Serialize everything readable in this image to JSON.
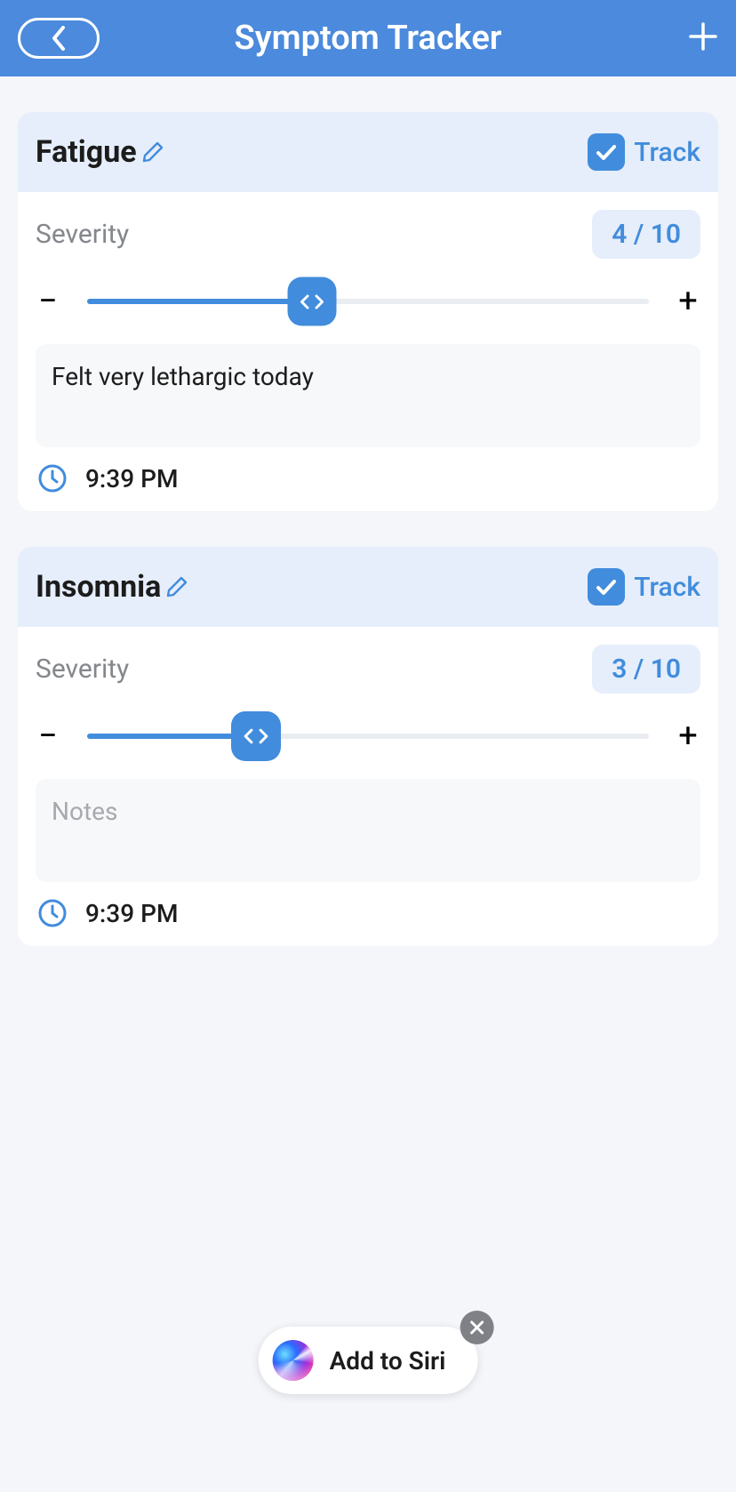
{
  "header": {
    "title": "Symptom Tracker"
  },
  "track_label": "Track",
  "severity_label": "Severity",
  "severity_max": 10,
  "notes_placeholder": "Notes",
  "symptoms": [
    {
      "name": "Fatigue",
      "tracked": true,
      "severity": 4,
      "severity_display": "4 / 10",
      "notes": "Felt very lethargic today",
      "time": "9:39 PM",
      "slider_fill_pct": 40,
      "thumb_w": 55,
      "thumb_h": 55
    },
    {
      "name": "Insomnia",
      "tracked": true,
      "severity": 3,
      "severity_display": "3 / 10",
      "notes": "",
      "time": "9:39 PM",
      "slider_fill_pct": 30,
      "thumb_w": 56,
      "thumb_h": 56
    }
  ],
  "siri": {
    "label": "Add to Siri"
  },
  "colors": {
    "header_bg": "#4b8adc",
    "accent": "#418cdc",
    "card_header_bg": "#e6eefb",
    "body_bg": "#f4f6fa",
    "muted_text": "#84878c"
  }
}
